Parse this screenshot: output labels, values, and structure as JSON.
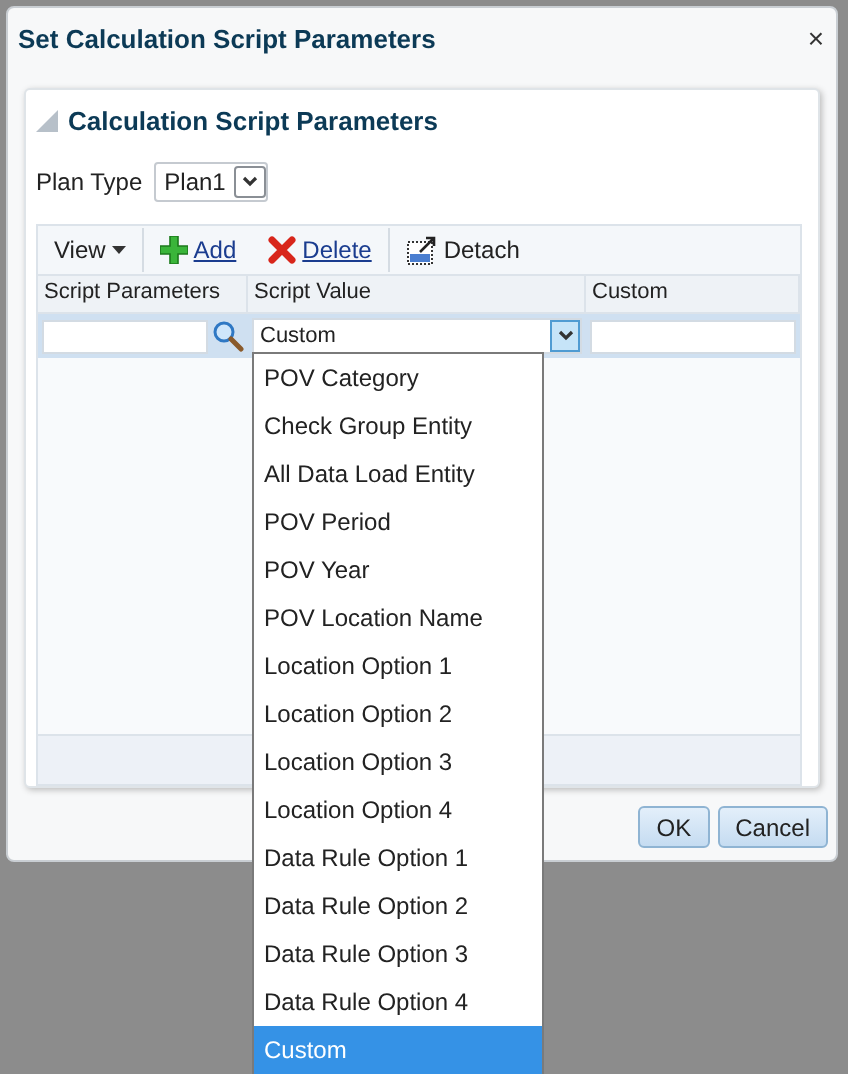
{
  "dialog": {
    "title": "Set Calculation Script Parameters",
    "close": "×"
  },
  "panel": {
    "title": "Calculation Script Parameters",
    "expanded": true
  },
  "plan_type": {
    "label": "Plan Type",
    "value": "Plan1"
  },
  "toolbar": [
    {
      "label": "View",
      "kind": "menu"
    },
    {
      "label": "Add",
      "kind": "add"
    },
    {
      "label": "Delete",
      "kind": "delete"
    },
    {
      "label": "Detach",
      "kind": "detach"
    }
  ],
  "table": {
    "columns": [
      "Script Parameters",
      "Script Value",
      "Custom"
    ],
    "rows": [
      {
        "script_value": "Custom",
        "selected": true
      }
    ]
  },
  "dropdown": {
    "options": [
      {
        "label": "POV Category",
        "selected": false
      },
      {
        "label": "Check Group Entity",
        "selected": false
      },
      {
        "label": "All Data Load Entity",
        "selected": false
      },
      {
        "label": "POV Period",
        "selected": false
      },
      {
        "label": "POV Year",
        "selected": false
      },
      {
        "label": "POV Location Name",
        "selected": false
      },
      {
        "label": "Location Option 1",
        "selected": false
      },
      {
        "label": "Location Option 2",
        "selected": false
      },
      {
        "label": "Location Option 3",
        "selected": false
      },
      {
        "label": "Location Option 4",
        "selected": false
      },
      {
        "label": "Data Rule Option 1",
        "selected": false
      },
      {
        "label": "Data Rule Option 2",
        "selected": false
      },
      {
        "label": "Data Rule Option 3",
        "selected": false
      },
      {
        "label": "Data Rule Option 4",
        "selected": false
      },
      {
        "label": "Custom",
        "selected": true
      }
    ]
  },
  "buttons": [
    "OK",
    "Cancel"
  ]
}
